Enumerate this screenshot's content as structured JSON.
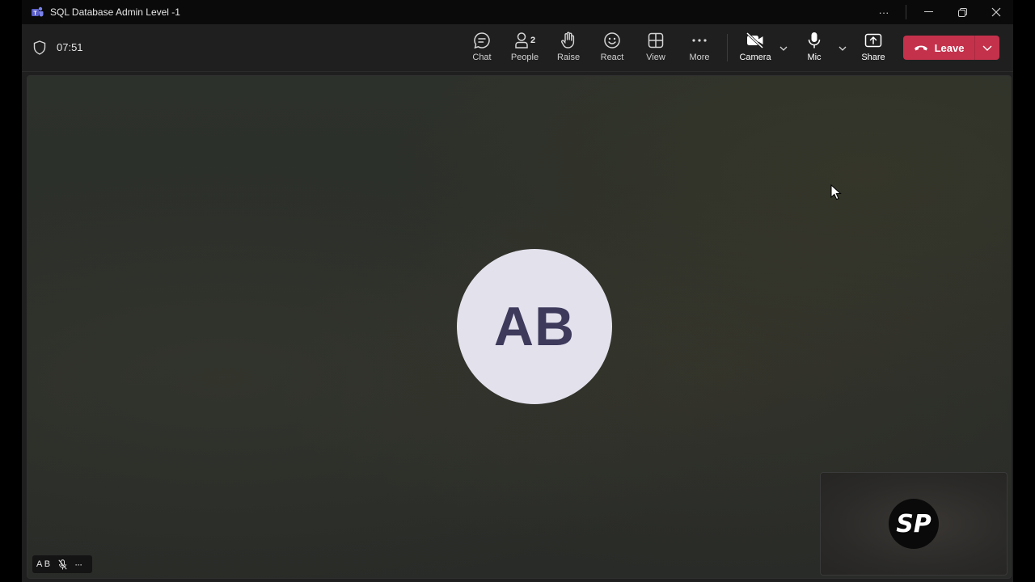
{
  "window": {
    "title": "SQL Database Admin Level -1",
    "controls": {
      "more": "···",
      "minimize": "—",
      "restore": "❐",
      "close": "✕"
    }
  },
  "meeting": {
    "timer": "07:51",
    "toolbar": {
      "chat": "Chat",
      "people": "People",
      "people_count": "2",
      "raise": "Raise",
      "react": "React",
      "view": "View",
      "more": "More",
      "camera": "Camera",
      "mic": "Mic",
      "share": "Share",
      "leave": "Leave"
    }
  },
  "participants": {
    "main": {
      "initials": "AB",
      "name_tag": "A B"
    },
    "self": {
      "logo_text": "SP"
    }
  },
  "colors": {
    "leave_button": "#c4314b",
    "avatar_bg": "#e3e1ec",
    "avatar_text": "#3d3a5c"
  },
  "icons": {
    "app": "teams-icon",
    "shield": "shield-icon",
    "chat": "chat-icon",
    "people": "people-icon",
    "raise": "hand-icon",
    "react": "smiley-icon",
    "view": "grid-icon",
    "more": "ellipsis-icon",
    "camera": "camera-off-icon",
    "mic": "mic-icon",
    "share": "share-icon",
    "leave": "phone-hangup-icon"
  }
}
